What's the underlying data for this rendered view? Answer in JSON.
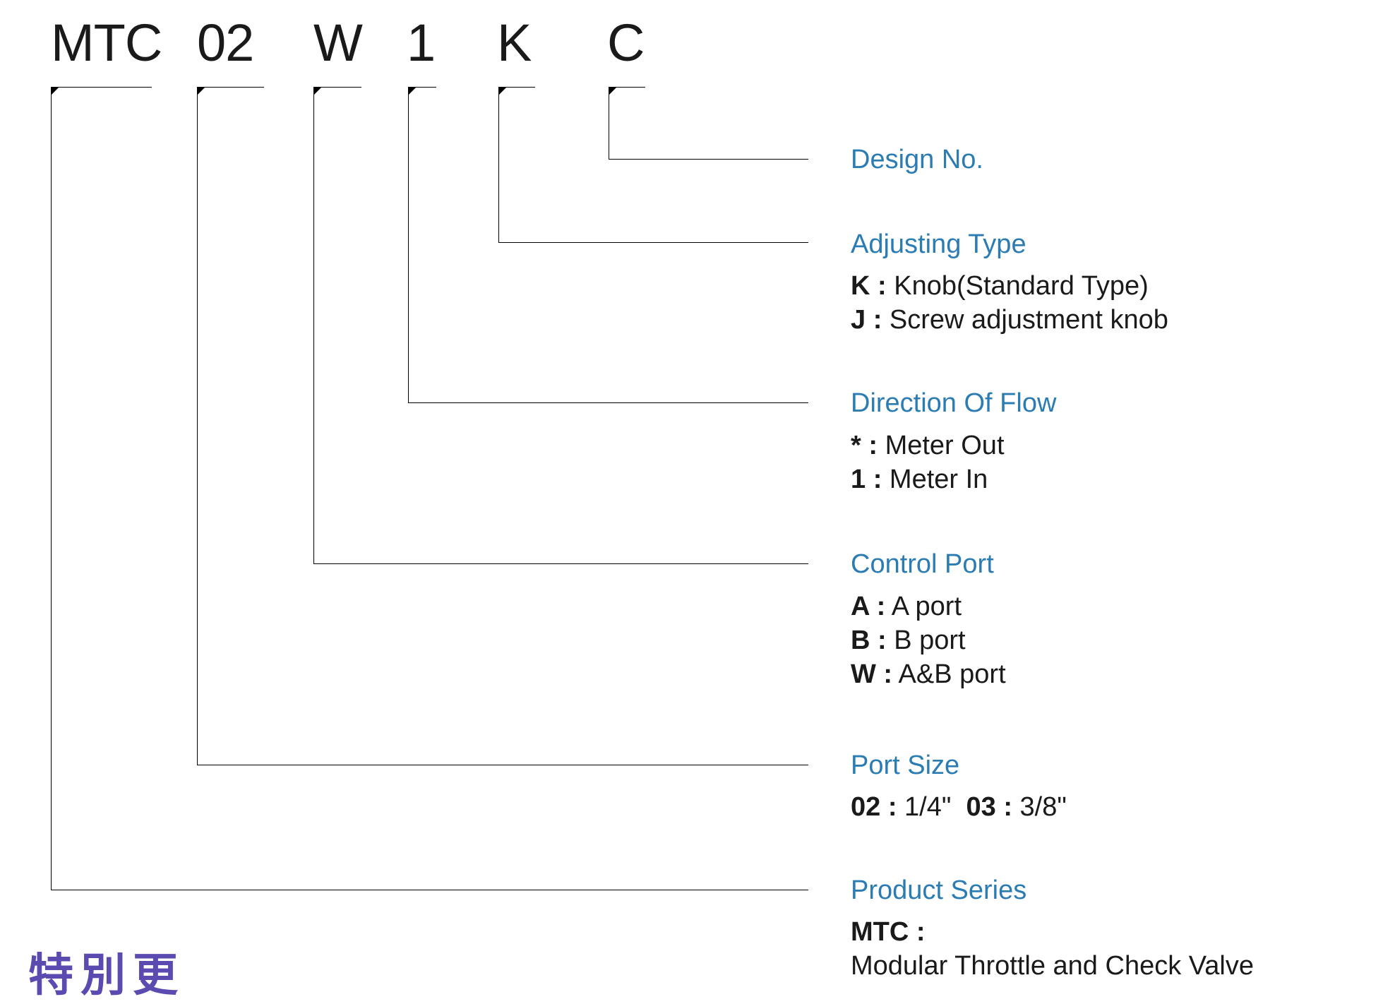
{
  "code": {
    "seg1": "MTC",
    "seg2": "02",
    "seg3": "W",
    "seg4": "1",
    "seg5": "K",
    "seg6": "C"
  },
  "sections": {
    "design_no": {
      "title": "Design No."
    },
    "adjusting_type": {
      "title": "Adjusting Type",
      "opt1_code": "K :",
      "opt1_label": "Knob(Standard Type)",
      "opt2_code": "J :",
      "opt2_label": "Screw adjustment knob"
    },
    "direction_of_flow": {
      "title": "Direction Of Flow",
      "opt1_code": "* :",
      "opt1_label": "Meter Out",
      "opt2_code": "1 :",
      "opt2_label": "Meter In"
    },
    "control_port": {
      "title": "Control Port",
      "opt1_code": "A :",
      "opt1_label": "A port",
      "opt2_code": "B :",
      "opt2_label": "B port",
      "opt3_code": "W :",
      "opt3_label": "A&B port"
    },
    "port_size": {
      "title": "Port Size",
      "opt1_code": "02 :",
      "opt1_label": "1/4\"",
      "opt2_code": "03 :",
      "opt2_label": "3/8\""
    },
    "product_series": {
      "title": "Product Series",
      "opt1_code": "MTC :",
      "opt1_label": "Modular Throttle and Check Valve"
    }
  },
  "bottom_text": "特別更"
}
